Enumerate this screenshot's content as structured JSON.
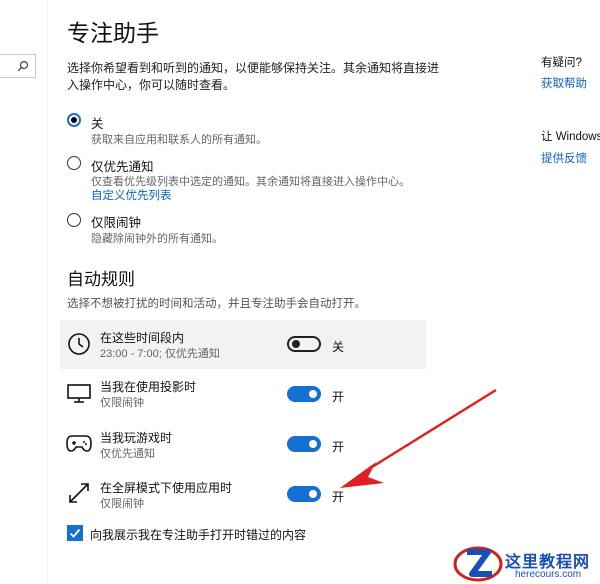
{
  "page": {
    "title": "专注助手",
    "description": "选择你希望看到和听到的通知，以便能够保持关注。其余通知将直接进入操作中心，你可以随时查看。"
  },
  "options": [
    {
      "label": "关",
      "sub": "获取来自应用和联系人的所有通知。",
      "checked": true
    },
    {
      "label": "仅优先通知",
      "sub": "仅查看优先级列表中选定的通知。其余通知将直接进入操作中心。",
      "link": "自定义优先列表",
      "checked": false
    },
    {
      "label": "仅限闹钟",
      "sub": "隐藏除闹钟外的所有通知。",
      "checked": false
    }
  ],
  "auto_rules": {
    "title": "自动规则",
    "description": "选择不想被打扰的时间和活动，并且专注助手会自动打开。",
    "rules": [
      {
        "title": "在这些时间段内",
        "sub": "23:00 - 7:00; 仅优先通知",
        "state": "关",
        "on": false,
        "icon": "clock-icon"
      },
      {
        "title": "当我在使用投影时",
        "sub": "仅限闹钟",
        "state": "开",
        "on": true,
        "icon": "monitor-icon"
      },
      {
        "title": "当我玩游戏时",
        "sub": "仅优先通知",
        "state": "开",
        "on": true,
        "icon": "gamepad-icon"
      },
      {
        "title": "在全屏模式下使用应用时",
        "sub": "仅限闹钟",
        "state": "开",
        "on": true,
        "icon": "fullscreen-icon"
      }
    ]
  },
  "summary_checkbox": {
    "label": "向我展示我在专注助手打开时错过的内容",
    "checked": true
  },
  "side": {
    "question": "有疑问?",
    "help": "获取帮助",
    "improve": "让 Windows",
    "feedback": "提供反馈"
  },
  "watermark": {
    "text": "这里教程网",
    "url": "herecours.com"
  },
  "colors": {
    "accent": "#1570d4",
    "link": "#0b63c4",
    "arrow": "#e02020"
  }
}
